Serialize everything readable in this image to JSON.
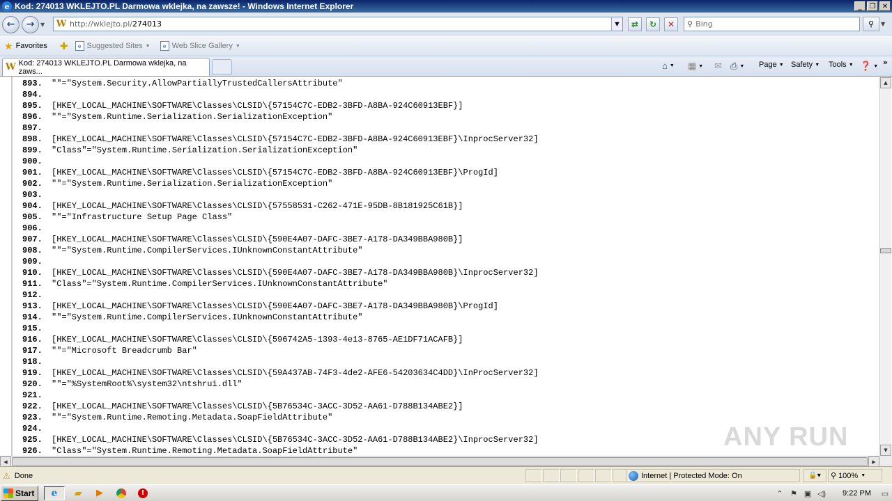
{
  "window": {
    "title": "Kod: 274013 WKLEJTO.PL Darmowa wklejka, na zawsze! - Windows Internet Explorer",
    "min": "_",
    "max": "❐",
    "close": "✕"
  },
  "addressbar": {
    "url_host": "http://wklejto.pl/",
    "url_path": "274013",
    "search_placeholder": "Bing"
  },
  "favorites_bar": {
    "favorites_label": "Favorites",
    "items": [
      "Suggested Sites",
      "Web Slice Gallery"
    ]
  },
  "tabs": [
    {
      "label": "Kod: 274013 WKLEJTO.PL Darmowa wklejka, na zaws..."
    }
  ],
  "commandbar": {
    "page": "Page",
    "safety": "Safety",
    "tools": "Tools"
  },
  "code_lines": [
    {
      "n": "893.",
      "t": "\"\"=\"System.Security.AllowPartiallyTrustedCallersAttribute\""
    },
    {
      "n": "894.",
      "t": ""
    },
    {
      "n": "895.",
      "t": "[HKEY_LOCAL_MACHINE\\SOFTWARE\\Classes\\CLSID\\{57154C7C-EDB2-3BFD-A8BA-924C60913EBF}]"
    },
    {
      "n": "896.",
      "t": "\"\"=\"System.Runtime.Serialization.SerializationException\""
    },
    {
      "n": "897.",
      "t": ""
    },
    {
      "n": "898.",
      "t": "[HKEY_LOCAL_MACHINE\\SOFTWARE\\Classes\\CLSID\\{57154C7C-EDB2-3BFD-A8BA-924C60913EBF}\\InprocServer32]"
    },
    {
      "n": "899.",
      "t": "\"Class\"=\"System.Runtime.Serialization.SerializationException\""
    },
    {
      "n": "900.",
      "t": ""
    },
    {
      "n": "901.",
      "t": "[HKEY_LOCAL_MACHINE\\SOFTWARE\\Classes\\CLSID\\{57154C7C-EDB2-3BFD-A8BA-924C60913EBF}\\ProgId]"
    },
    {
      "n": "902.",
      "t": "\"\"=\"System.Runtime.Serialization.SerializationException\""
    },
    {
      "n": "903.",
      "t": ""
    },
    {
      "n": "904.",
      "t": "[HKEY_LOCAL_MACHINE\\SOFTWARE\\Classes\\CLSID\\{57558531-C262-471E-95DB-8B181925C61B}]"
    },
    {
      "n": "905.",
      "t": "\"\"=\"Infrastructure Setup Page Class\""
    },
    {
      "n": "906.",
      "t": ""
    },
    {
      "n": "907.",
      "t": "[HKEY_LOCAL_MACHINE\\SOFTWARE\\Classes\\CLSID\\{590E4A07-DAFC-3BE7-A178-DA349BBA980B}]"
    },
    {
      "n": "908.",
      "t": "\"\"=\"System.Runtime.CompilerServices.IUnknownConstantAttribute\""
    },
    {
      "n": "909.",
      "t": ""
    },
    {
      "n": "910.",
      "t": "[HKEY_LOCAL_MACHINE\\SOFTWARE\\Classes\\CLSID\\{590E4A07-DAFC-3BE7-A178-DA349BBA980B}\\InprocServer32]"
    },
    {
      "n": "911.",
      "t": "\"Class\"=\"System.Runtime.CompilerServices.IUnknownConstantAttribute\""
    },
    {
      "n": "912.",
      "t": ""
    },
    {
      "n": "913.",
      "t": "[HKEY_LOCAL_MACHINE\\SOFTWARE\\Classes\\CLSID\\{590E4A07-DAFC-3BE7-A178-DA349BBA980B}\\ProgId]"
    },
    {
      "n": "914.",
      "t": "\"\"=\"System.Runtime.CompilerServices.IUnknownConstantAttribute\""
    },
    {
      "n": "915.",
      "t": ""
    },
    {
      "n": "916.",
      "t": "[HKEY_LOCAL_MACHINE\\SOFTWARE\\Classes\\CLSID\\{596742A5-1393-4e13-8765-AE1DF71ACAFB}]"
    },
    {
      "n": "917.",
      "t": "\"\"=\"Microsoft Breadcrumb Bar\""
    },
    {
      "n": "918.",
      "t": ""
    },
    {
      "n": "919.",
      "t": "[HKEY_LOCAL_MACHINE\\SOFTWARE\\Classes\\CLSID\\{59A437AB-74F3-4de2-AFE6-54203634C4DD}\\InProcServer32]"
    },
    {
      "n": "920.",
      "t": "\"\"=\"%SystemRoot%\\system32\\ntshrui.dll\""
    },
    {
      "n": "921.",
      "t": ""
    },
    {
      "n": "922.",
      "t": "[HKEY_LOCAL_MACHINE\\SOFTWARE\\Classes\\CLSID\\{5B76534C-3ACC-3D52-AA61-D788B134ABE2}]"
    },
    {
      "n": "923.",
      "t": "\"\"=\"System.Runtime.Remoting.Metadata.SoapFieldAttribute\""
    },
    {
      "n": "924.",
      "t": ""
    },
    {
      "n": "925.",
      "t": "[HKEY_LOCAL_MACHINE\\SOFTWARE\\Classes\\CLSID\\{5B76534C-3ACC-3D52-AA61-D788B134ABE2}\\InprocServer32]"
    },
    {
      "n": "926.",
      "t": "\"Class\"=\"System.Runtime.Remoting.Metadata.SoapFieldAttribute\""
    }
  ],
  "watermark": "ANY RUN",
  "statusbar": {
    "status_text": "Done",
    "zone_text": "Internet | Protected Mode: On",
    "zoom": "100%"
  },
  "taskbar": {
    "start_label": "Start",
    "clock": "9:22 PM"
  },
  "colors": {
    "title_bar": "#0a246a",
    "brand_fav": "#b07a00"
  },
  "icons": {
    "back": "back-arrow-icon",
    "forward": "forward-arrow-icon",
    "refresh": "refresh-icon",
    "stop": "stop-icon",
    "compat": "compatibility-view-icon",
    "search": "search-icon",
    "home": "home-icon",
    "feeds": "rss-icon",
    "mail": "mail-icon",
    "print": "print-icon",
    "help": "help-icon"
  }
}
